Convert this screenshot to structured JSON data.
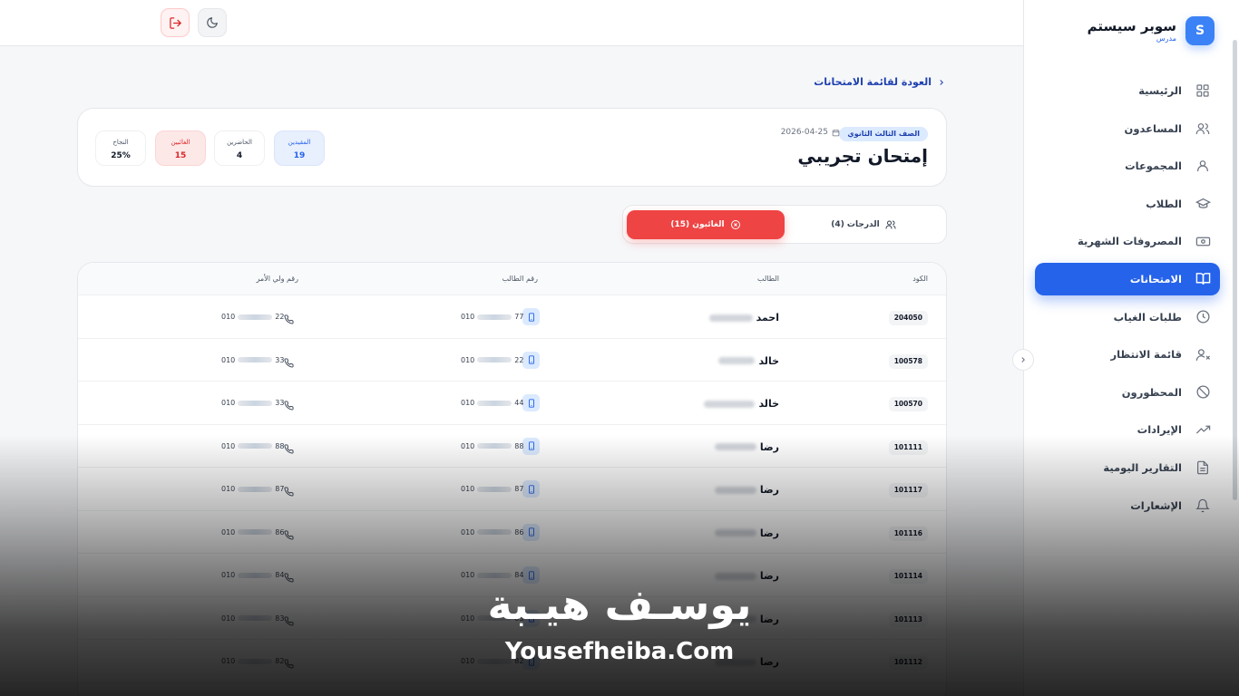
{
  "brand": {
    "title": "سوبر سيستم",
    "subtitle": "مدرس",
    "logo_letter": "S",
    "accent": "#2563eb"
  },
  "sidebar": {
    "items": [
      {
        "label": "الرئيسية",
        "icon": "grid-icon",
        "active": false
      },
      {
        "label": "المساعدون",
        "icon": "users-icon",
        "active": false
      },
      {
        "label": "المجموعات",
        "icon": "user-group-icon",
        "active": false
      },
      {
        "label": "الطلاب",
        "icon": "graduation-cap-icon",
        "active": false
      },
      {
        "label": "المصروفات الشهرية",
        "icon": "money-icon",
        "active": false
      },
      {
        "label": "الامتحانات",
        "icon": "book-open-icon",
        "active": true
      },
      {
        "label": "طلبات الغياب",
        "icon": "clock-icon",
        "active": false
      },
      {
        "label": "قائمة الانتظار",
        "icon": "user-x-icon",
        "active": false
      },
      {
        "label": "المحظورون",
        "icon": "ban-icon",
        "active": false
      },
      {
        "label": "الإيرادات",
        "icon": "trending-up-icon",
        "active": false
      },
      {
        "label": "التقارير اليومية",
        "icon": "file-text-icon",
        "active": false
      },
      {
        "label": "الإشعارات",
        "icon": "bell-icon",
        "active": false
      }
    ]
  },
  "topbar": {
    "logout_icon": "logout-icon",
    "theme_icon": "moon-icon"
  },
  "back_link": "العودة لقائمة الامتحانات",
  "exam": {
    "grade": "الصف الثالث الثانوي",
    "date": "2026-04-25",
    "title": "إمتحان تجريبي",
    "stats": {
      "enrolled": {
        "label": "المقيدين",
        "value": "19"
      },
      "present": {
        "label": "الحاضرين",
        "value": "4"
      },
      "absent": {
        "label": "الغائبين",
        "value": "15"
      },
      "success": {
        "label": "النجاح",
        "value": "25%"
      }
    }
  },
  "tabs": {
    "grades": "الدرجات (4)",
    "absent": "الغائبون (15)"
  },
  "table": {
    "headers": {
      "code": "الكود",
      "student": "الطالب",
      "student_phone": "رقم الطالب",
      "parent_phone": "رقم ولي الأمر"
    },
    "rows": [
      {
        "code": "204050",
        "name": "احمد",
        "student_prefix": "010",
        "student_suffix": "77",
        "parent_prefix": "010",
        "parent_suffix": "22"
      },
      {
        "code": "100578",
        "name": "خالد",
        "student_prefix": "010",
        "student_suffix": "22",
        "parent_prefix": "010",
        "parent_suffix": "33"
      },
      {
        "code": "100570",
        "name": "خالد",
        "student_prefix": "010",
        "student_suffix": "44",
        "parent_prefix": "010",
        "parent_suffix": "33"
      },
      {
        "code": "101111",
        "name": "رضا",
        "student_prefix": "010",
        "student_suffix": "88",
        "parent_prefix": "010",
        "parent_suffix": "88"
      },
      {
        "code": "101117",
        "name": "رضا",
        "student_prefix": "010",
        "student_suffix": "87",
        "parent_prefix": "010",
        "parent_suffix": "87"
      },
      {
        "code": "101116",
        "name": "رضا",
        "student_prefix": "010",
        "student_suffix": "86",
        "parent_prefix": "010",
        "parent_suffix": "86"
      },
      {
        "code": "101114",
        "name": "رضا",
        "student_prefix": "010",
        "student_suffix": "84",
        "parent_prefix": "010",
        "parent_suffix": "84"
      },
      {
        "code": "101113",
        "name": "رضا",
        "student_prefix": "010",
        "student_suffix": "83",
        "parent_prefix": "010",
        "parent_suffix": "83"
      },
      {
        "code": "101112",
        "name": "رضا",
        "student_prefix": "010",
        "student_suffix": "82",
        "parent_prefix": "010",
        "parent_suffix": "82"
      }
    ]
  },
  "watermark": {
    "arabic": "يوسـف هيـبة",
    "latin": "Yousefheiba.Com"
  }
}
